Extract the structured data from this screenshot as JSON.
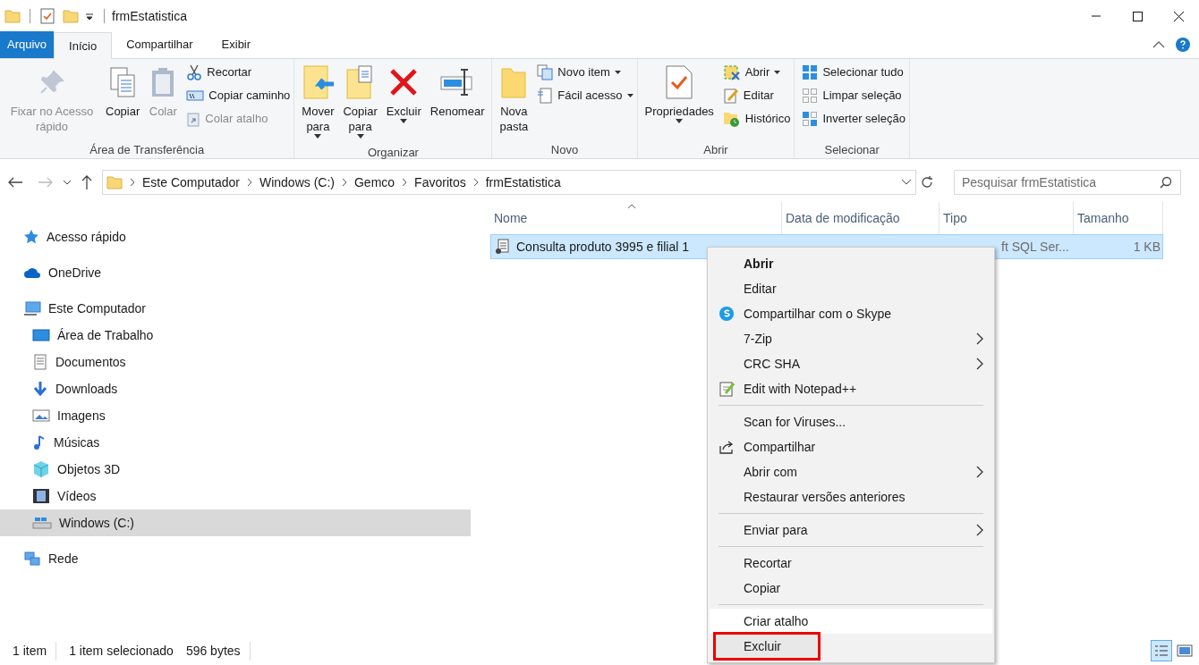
{
  "window": {
    "title": "frmEstatistica"
  },
  "tabs": [
    {
      "label": "Arquivo",
      "kind": "file",
      "selected": false
    },
    {
      "label": "Início",
      "kind": "tab",
      "selected": true
    },
    {
      "label": "Compartilhar",
      "kind": "tab",
      "selected": false
    },
    {
      "label": "Exibir",
      "kind": "tab",
      "selected": false
    }
  ],
  "ribbon": [
    {
      "label": "Área de Transferência",
      "large": [
        {
          "label": "Fixar no Acesso rápido",
          "disabled": true
        },
        {
          "label": "Copiar",
          "disabled": false
        },
        {
          "label": "Colar",
          "disabled": true
        }
      ],
      "small": [
        {
          "label": "Recortar",
          "disabled": false
        },
        {
          "label": "Copiar caminho",
          "disabled": false
        },
        {
          "label": "Colar atalho",
          "disabled": true
        }
      ]
    },
    {
      "label": "Organizar",
      "large": [
        {
          "label": "Mover para",
          "disabled": false,
          "dropdown": true
        },
        {
          "label": "Copiar para",
          "disabled": false,
          "dropdown": true
        },
        {
          "label": "Excluir",
          "disabled": false,
          "dropdown": true
        },
        {
          "label": "Renomear",
          "disabled": false
        }
      ]
    },
    {
      "label": "Novo",
      "large": [
        {
          "label": "Nova pasta",
          "disabled": false
        }
      ],
      "small": [
        {
          "label": "Novo item",
          "disabled": false,
          "dropdown": true
        },
        {
          "label": "Fácil acesso",
          "disabled": false,
          "dropdown": true
        }
      ]
    },
    {
      "label": "Abrir",
      "large": [
        {
          "label": "Propriedades",
          "disabled": false,
          "dropdown": true
        }
      ],
      "small": [
        {
          "label": "Abrir",
          "disabled": false,
          "dropdown": true
        },
        {
          "label": "Editar",
          "disabled": false
        },
        {
          "label": "Histórico",
          "disabled": false
        }
      ]
    },
    {
      "label": "Selecionar",
      "small": [
        {
          "label": "Selecionar tudo",
          "disabled": false
        },
        {
          "label": "Limpar seleção",
          "disabled": false
        },
        {
          "label": "Inverter seleção",
          "disabled": false
        }
      ]
    }
  ],
  "address": {
    "path": [
      "Este Computador",
      "Windows (C:)",
      "Gemco",
      "Favoritos",
      "frmEstatistica"
    ],
    "search_placeholder": "Pesquisar frmEstatistica"
  },
  "sidebar": [
    {
      "label": "Acesso rápido",
      "selected": false
    },
    {
      "label": "OneDrive",
      "selected": false
    },
    {
      "label": "Este Computador",
      "selected": false,
      "children": [
        {
          "label": "Área de Trabalho",
          "selected": false
        },
        {
          "label": "Documentos",
          "selected": false
        },
        {
          "label": "Downloads",
          "selected": false
        },
        {
          "label": "Imagens",
          "selected": false
        },
        {
          "label": "Músicas",
          "selected": false
        },
        {
          "label": "Objetos 3D",
          "selected": false
        },
        {
          "label": "Vídeos",
          "selected": false
        },
        {
          "label": "Windows (C:)",
          "selected": true
        }
      ]
    },
    {
      "label": "Rede",
      "selected": false
    }
  ],
  "columns": [
    "Nome",
    "Data de modificação",
    "Tipo",
    "Tamanho"
  ],
  "files": [
    {
      "name": "Consulta produto 3995 e filial 1",
      "type": "ft SQL Ser...",
      "size": "1 KB",
      "selected": true
    }
  ],
  "context_menu": [
    [
      {
        "label": "Abrir",
        "bold": true
      },
      {
        "label": "Editar"
      },
      {
        "label": "Compartilhar com o Skype"
      },
      {
        "label": "7-Zip",
        "submenu": true
      },
      {
        "label": "CRC SHA",
        "submenu": true
      },
      {
        "label": "Edit with Notepad++"
      }
    ],
    [
      {
        "label": "Scan for Viruses..."
      },
      {
        "label": "Compartilhar"
      },
      {
        "label": "Abrir com",
        "submenu": true
      },
      {
        "label": "Restaurar versões anteriores"
      }
    ],
    [
      {
        "label": "Enviar para",
        "submenu": true
      }
    ],
    [
      {
        "label": "Recortar"
      },
      {
        "label": "Copiar"
      }
    ],
    [
      {
        "label": "Criar atalho"
      },
      {
        "label": "Excluir",
        "highlighted": true
      }
    ]
  ],
  "status_bar": {
    "count": "1 item",
    "selection": "1 item selecionado",
    "size": "596 bytes"
  }
}
